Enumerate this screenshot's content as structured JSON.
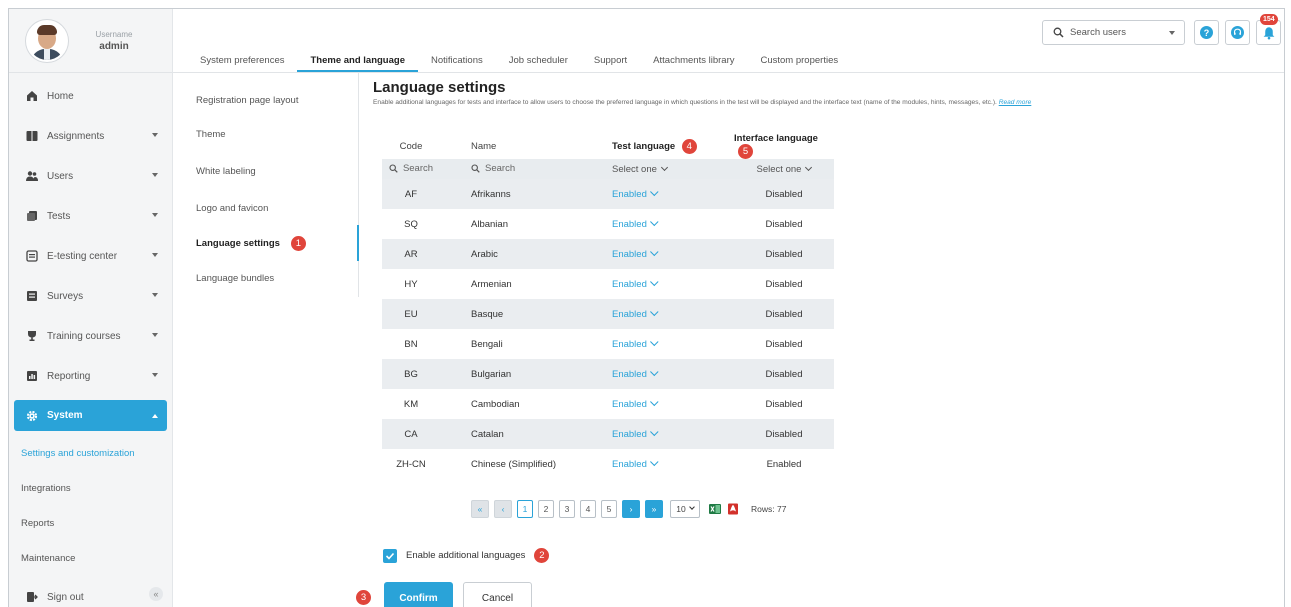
{
  "profile": {
    "username_label": "Username",
    "username": "admin"
  },
  "sidebar": {
    "items": [
      {
        "label": "Home",
        "icon": "home-icon"
      },
      {
        "label": "Assignments",
        "icon": "assignments-icon"
      },
      {
        "label": "Users",
        "icon": "users-icon"
      },
      {
        "label": "Tests",
        "icon": "tests-icon"
      },
      {
        "label": "E-testing center",
        "icon": "e-testing-icon"
      },
      {
        "label": "Surveys",
        "icon": "surveys-icon"
      },
      {
        "label": "Training courses",
        "icon": "training-icon"
      },
      {
        "label": "Reporting",
        "icon": "reporting-icon"
      },
      {
        "label": "System",
        "icon": "gear-icon"
      }
    ],
    "sub_items": [
      "Settings and customization",
      "Integrations",
      "Reports",
      "Maintenance"
    ],
    "sign_out": "Sign out",
    "collapse_glyph": "«"
  },
  "tabs": [
    "System preferences",
    "Theme and language",
    "Notifications",
    "Job scheduler",
    "Support",
    "Attachments library",
    "Custom properties"
  ],
  "header": {
    "search_placeholder": "Search users",
    "notification_count": "154",
    "help_glyph": "?"
  },
  "settings_menu": [
    "Registration page layout",
    "Theme",
    "White labeling",
    "Logo and favicon",
    "Language settings",
    "Language bundles"
  ],
  "main": {
    "title": "Language settings",
    "description": "Enable additional languages for tests and interface to allow users to choose the preferred language in which questions in the test will be displayed and the interface text (name of the modules, hints, messages, etc.).",
    "read_more": "Read more"
  },
  "table": {
    "headers": {
      "code": "Code",
      "name": "Name",
      "test": "Test language",
      "iface": "Interface language"
    },
    "filters": {
      "search": "Search",
      "select": "Select one"
    },
    "rows": [
      {
        "code": "AF",
        "name": "Afrikanns",
        "test": "Enabled",
        "iface": "Disabled"
      },
      {
        "code": "SQ",
        "name": "Albanian",
        "test": "Enabled",
        "iface": "Disabled"
      },
      {
        "code": "AR",
        "name": "Arabic",
        "test": "Enabled",
        "iface": "Disabled"
      },
      {
        "code": "HY",
        "name": "Armenian",
        "test": "Enabled",
        "iface": "Disabled"
      },
      {
        "code": "EU",
        "name": "Basque",
        "test": "Enabled",
        "iface": "Disabled"
      },
      {
        "code": "BN",
        "name": "Bengali",
        "test": "Enabled",
        "iface": "Disabled"
      },
      {
        "code": "BG",
        "name": "Bulgarian",
        "test": "Enabled",
        "iface": "Disabled"
      },
      {
        "code": "KM",
        "name": "Cambodian",
        "test": "Enabled",
        "iface": "Disabled"
      },
      {
        "code": "CA",
        "name": "Catalan",
        "test": "Enabled",
        "iface": "Disabled"
      },
      {
        "code": "ZH-CN",
        "name": "Chinese (Simplified)",
        "test": "Enabled",
        "iface": "Enabled"
      }
    ]
  },
  "pagination": {
    "first": "«",
    "prev": "‹",
    "pages": [
      "1",
      "2",
      "3",
      "4",
      "5"
    ],
    "next": "›",
    "last": "»",
    "rows_per_page": "10",
    "rows_count": "Rows: 77"
  },
  "footer": {
    "enable_label": "Enable additional languages",
    "confirm": "Confirm",
    "cancel": "Cancel"
  },
  "callouts": [
    "1",
    "2",
    "3",
    "4",
    "5"
  ],
  "colors": {
    "accent": "#2aa3d8",
    "danger": "#e0453b",
    "success": "#3aa757",
    "excel": "#1f7a44",
    "pdf": "#d2312b"
  }
}
